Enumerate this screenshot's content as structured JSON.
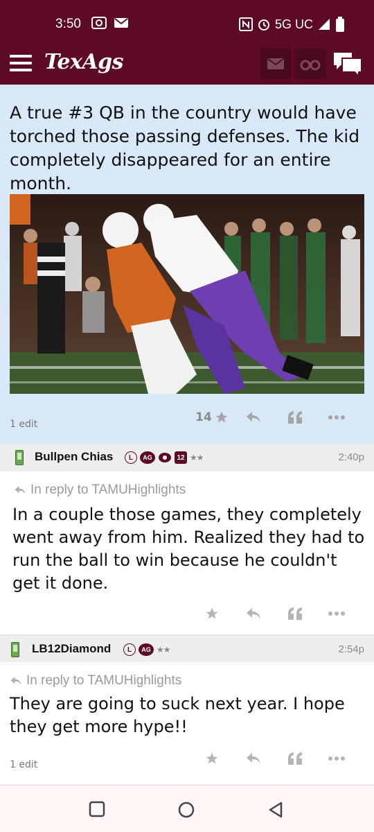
{
  "status_bar": {
    "time": "3:50",
    "network": "5G UC"
  },
  "app_bar": {
    "brand": "TexAgs"
  },
  "op": {
    "text": "A true #3 QB in the country would have torched those passing defenses. The kid completely disappeared for an entire month.",
    "edit_note": "1 edit",
    "star_count": "14"
  },
  "replies": [
    {
      "username": "Bullpen Chias",
      "badges": [
        "L",
        "AG",
        "12"
      ],
      "stars": "★★",
      "time": "2:40p",
      "in_reply_to": "In reply to TAMUHighlights",
      "text": "In a couple those games, they completely went away from him. Realized they had to run the ball to win because he couldn't get it done."
    },
    {
      "username": "LB12Diamond",
      "badges": [
        "L",
        "AG"
      ],
      "stars": "★★",
      "time": "2:54p",
      "in_reply_to": "In reply to TAMUHighlights",
      "text": "They are going to suck next year. I hope they get more hype!!",
      "edit_note": "1 edit"
    }
  ],
  "colors": {
    "brand": "#5d0a26",
    "op_bg": "#d9e8f7"
  }
}
